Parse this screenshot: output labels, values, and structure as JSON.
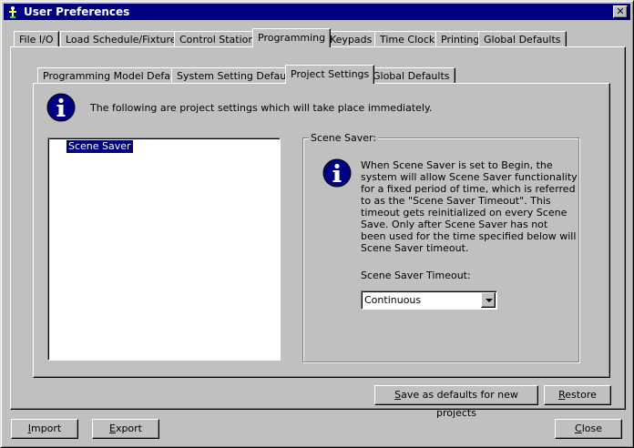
{
  "window": {
    "title": "User Preferences",
    "close_glyph": "✕"
  },
  "main_tabs": [
    {
      "label": "File I/O"
    },
    {
      "label": "Load Schedule/Fixtures"
    },
    {
      "label": "Control Stations"
    },
    {
      "label": "Programming"
    },
    {
      "label": "Keypads"
    },
    {
      "label": "Time Clock"
    },
    {
      "label": "Printing"
    },
    {
      "label": "Global Defaults"
    }
  ],
  "sub_tabs": [
    {
      "label": "Programming Model Defaults"
    },
    {
      "label": "System Setting Defaults"
    },
    {
      "label": "Project Settings"
    },
    {
      "label": "Global Defaults"
    }
  ],
  "info_text": "The following are project settings which will take place immediately.",
  "settings_list": {
    "items": [
      "Scene Saver"
    ],
    "selected": "Scene Saver"
  },
  "scene_saver": {
    "group_label": "Scene Saver:",
    "description_lines": [
      "When Scene Saver is set to Begin, the",
      "system will allow Scene Saver functionality",
      "for a fixed period of time, which is referred",
      "to as the \"Scene Saver Timeout\".  This",
      "timeout gets reinitialized on every Scene",
      "Save.  Only after Scene Saver has not",
      "been used for the time specified below will",
      "Scene Saver timeout."
    ],
    "timeout_label": "Scene Saver Timeout:",
    "timeout_value": "Continuous"
  },
  "buttons": {
    "save_defaults_access": "S",
    "save_defaults_rest": "ave as defaults for new projects",
    "restore_access": "R",
    "restore_rest": "estore",
    "import_access": "I",
    "import_rest": "mport",
    "export_access": "E",
    "export_rest": "xport",
    "close_access": "C",
    "close_rest": "lose"
  },
  "colors": {
    "titlebar": "#000080",
    "face": "#c0c0c0",
    "selection": "#000080"
  },
  "icons": [
    "app-icon",
    "info-icon",
    "close-icon",
    "dropdown-arrow-icon"
  ]
}
